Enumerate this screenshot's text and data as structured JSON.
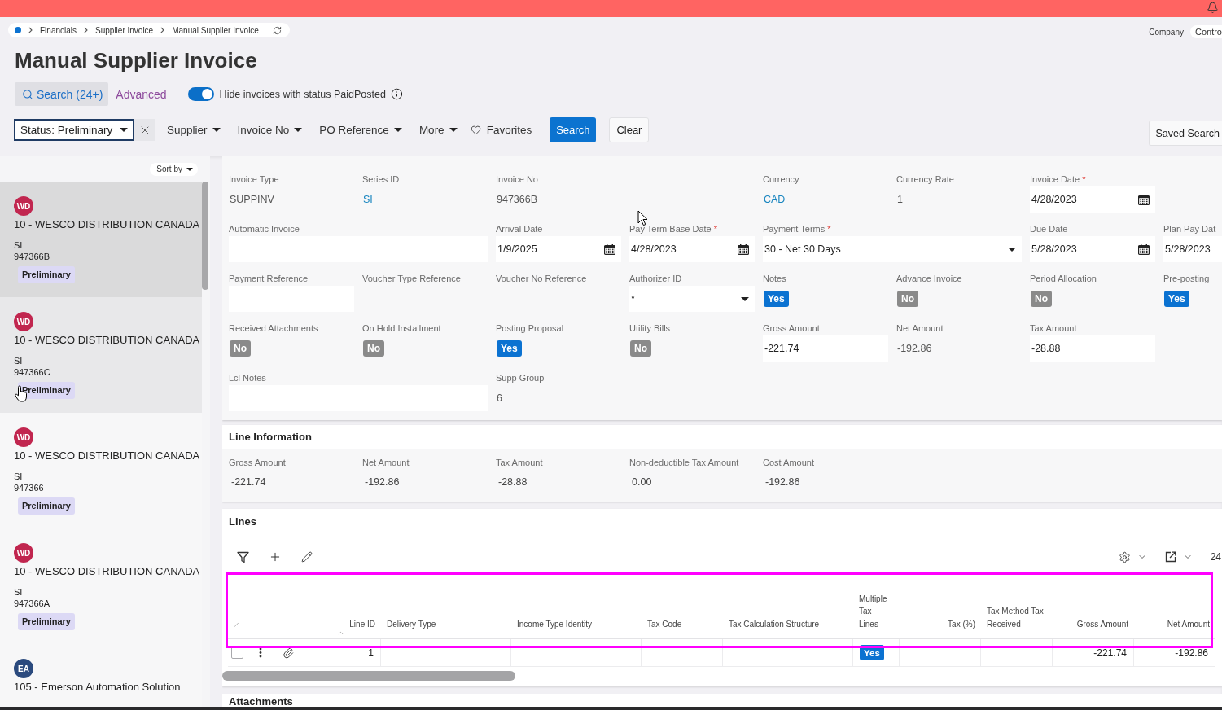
{
  "breadcrumb": {
    "items": [
      "Financials",
      "Supplier Invoice",
      "Manual Supplier Invoice"
    ]
  },
  "company": {
    "label": "Company",
    "value": "Contro"
  },
  "title": "Manual Supplier Invoice",
  "search_bar": {
    "search_button": "Search (24+)",
    "advanced_link": "Advanced",
    "toggle": {
      "label": "Hide invoices with status PaidPosted",
      "on": true
    }
  },
  "filters": {
    "status_filter": "Status: Preliminary",
    "dropdowns": [
      "Supplier",
      "Invoice No",
      "PO Reference",
      "More"
    ],
    "favorites": "Favorites",
    "search_button": "Search",
    "clear_button": "Clear",
    "saved_search_button": "Saved Search"
  },
  "invoice_list": {
    "sort_label": "Sort by",
    "items": [
      {
        "initials": "WD",
        "color": "#c1264f",
        "supplier": "10 - WESCO DISTRIBUTION CANADA",
        "series": "SI",
        "invoice_no": "947366B",
        "status": "Preliminary",
        "selected": true,
        "hovered": false
      },
      {
        "initials": "WD",
        "color": "#c1264f",
        "supplier": "10 - WESCO DISTRIBUTION CANADA",
        "series": "SI",
        "invoice_no": "947366C",
        "status": "Preliminary",
        "selected": false,
        "hovered": true
      },
      {
        "initials": "WD",
        "color": "#c1264f",
        "supplier": "10 - WESCO DISTRIBUTION CANADA",
        "series": "SI",
        "invoice_no": "947366",
        "status": "Preliminary",
        "selected": false,
        "hovered": false
      },
      {
        "initials": "WD",
        "color": "#c1264f",
        "supplier": "10 - WESCO DISTRIBUTION CANADA",
        "series": "SI",
        "invoice_no": "947366A",
        "status": "Preliminary",
        "selected": false,
        "hovered": false
      },
      {
        "initials": "EA",
        "color": "#2b4a7e",
        "supplier": "105 - Emerson Automation Solution",
        "selected": false,
        "hovered": false
      }
    ]
  },
  "invoice_form": {
    "rows": [
      [
        {
          "label": "Invoice Type",
          "kind": "text",
          "value": "SUPPINV"
        },
        {
          "label": "Series ID",
          "kind": "link",
          "value": "SI"
        },
        {
          "label": "Invoice No",
          "kind": "text",
          "value": "947366B"
        },
        "",
        {
          "label": "Currency",
          "kind": "link",
          "value": "CAD"
        },
        {
          "label": "Currency Rate",
          "kind": "text",
          "value": "1"
        },
        {
          "label": "Invoice Date",
          "kind": "date",
          "value": "4/28/2023",
          "required_mark": "*"
        }
      ],
      [
        {
          "label": "Automatic Invoice",
          "kind": "wide-input"
        },
        "",
        {
          "label": "Arrival Date",
          "kind": "date",
          "value": "1/9/2025"
        },
        {
          "label": "Pay Term Base Date",
          "kind": "date",
          "value": "4/28/2023",
          "required_mark": "*"
        },
        {
          "label": "Payment Terms",
          "kind": "wide-select",
          "value": "30 - Net 30 Days",
          "required_mark": "*"
        },
        "",
        {
          "label": "Due Date",
          "kind": "date",
          "value": "5/28/2023"
        },
        {
          "label": "Plan Pay Dat",
          "kind": "input",
          "value": "5/28/2023"
        }
      ],
      [
        {
          "label": "Payment Reference",
          "kind": "input"
        },
        {
          "label": "Voucher Type Reference",
          "kind": "text"
        },
        {
          "label": "Voucher No Reference",
          "kind": "text"
        },
        {
          "label": "Authorizer ID",
          "kind": "select",
          "value": "*"
        },
        {
          "label": "Notes",
          "kind": "flag",
          "value": "Yes",
          "on": true
        },
        {
          "label": "Advance Invoice",
          "kind": "flag",
          "value": "No",
          "on": false
        },
        {
          "label": "Period Allocation",
          "kind": "flag",
          "value": "No",
          "on": false
        },
        {
          "label": "Pre-posting",
          "kind": "flag",
          "value": "Yes",
          "on": true
        }
      ],
      [
        {
          "label": "Received Attachments",
          "kind": "flag",
          "value": "No",
          "on": false
        },
        {
          "label": "On Hold Installment",
          "kind": "flag",
          "value": "No",
          "on": false
        },
        {
          "label": "Posting Proposal",
          "kind": "flag",
          "value": "Yes",
          "on": true
        },
        {
          "label": "Utility Bills",
          "kind": "flag",
          "value": "No",
          "on": false
        },
        {
          "label": "Gross Amount",
          "kind": "input",
          "value": "-221.74"
        },
        {
          "label": "Net Amount",
          "kind": "text",
          "value": "-192.86"
        },
        {
          "label": "Tax Amount",
          "kind": "input",
          "value": "-28.88"
        }
      ],
      [
        {
          "label": "Lcl Notes",
          "kind": "wide-input"
        },
        "",
        {
          "label": "Supp Group",
          "kind": "text",
          "value": "6"
        }
      ]
    ]
  },
  "line_information": {
    "title": "Line Information",
    "fields": [
      {
        "label": "Gross Amount",
        "value": "-221.74"
      },
      {
        "label": "Net Amount",
        "value": "-192.86"
      },
      {
        "label": "Tax Amount",
        "value": "-28.88"
      },
      {
        "label": "Non-deductible Tax Amount",
        "value": "0.00"
      },
      {
        "label": "Cost Amount",
        "value": "-192.86"
      }
    ]
  },
  "lines_table": {
    "title": "Lines",
    "count": "24",
    "header_highlighted": true,
    "columns": [
      {
        "label": "Line ID",
        "kind": "number",
        "sorted": true
      },
      {
        "label": "Delivery Type",
        "kind": "text",
        "sorted": false
      },
      {
        "label": "Income Type Identity",
        "kind": "text",
        "sorted": false
      },
      {
        "label": "Tax Code",
        "kind": "text",
        "sorted": false
      },
      {
        "label": "Tax Calculation Structure",
        "kind": "text",
        "sorted": false
      },
      {
        "label": "Multiple Tax Lines",
        "kind": "flag",
        "sorted": false
      },
      {
        "label": "Tax (%)",
        "kind": "number",
        "sorted": false
      },
      {
        "label": "Tax Method Tax Received",
        "kind": "text",
        "sorted": false
      },
      {
        "label": "Gross Amount",
        "kind": "number",
        "sorted": false
      },
      {
        "label": "Net Amount",
        "kind": "number",
        "sorted": false
      }
    ],
    "rows": [
      {
        "selected": false,
        "cells": [
          "1",
          null,
          null,
          null,
          null,
          {
            "text": "Yes",
            "on": true
          },
          null,
          null,
          "-221.74",
          "-192.86"
        ]
      }
    ]
  },
  "attachments": {
    "title": "Attachments"
  }
}
